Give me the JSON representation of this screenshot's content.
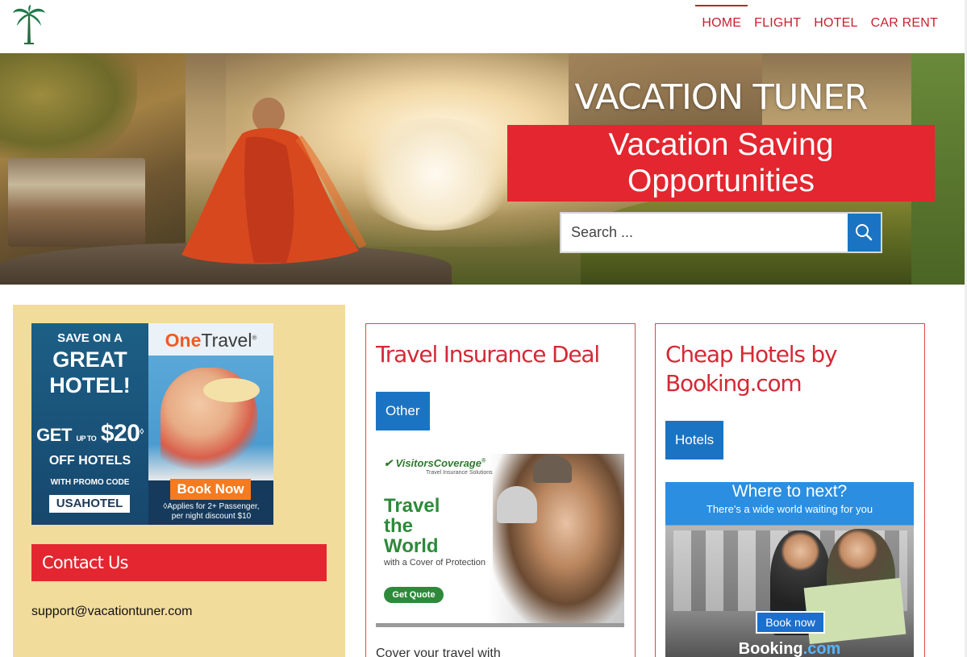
{
  "header": {
    "logo_icon": "palm-tree-icon",
    "nav": [
      {
        "label": "HOME",
        "active": true
      },
      {
        "label": "FLIGHT",
        "active": false
      },
      {
        "label": "HOTEL",
        "active": false
      },
      {
        "label": "CAR RENT",
        "active": false
      }
    ]
  },
  "hero": {
    "site_title": "VACATION TUNER",
    "tagline_line1": "Vacation Saving",
    "tagline_line2": "Opportunities",
    "search_placeholder": "Search ...",
    "search_icon": "search-icon"
  },
  "sidebar": {
    "ad": {
      "line1": "SAVE ON A",
      "line2": "GREAT",
      "line3": "HOTEL!",
      "get": "GET",
      "up_to": "UP TO",
      "amount": "$20",
      "sup": "◊",
      "off": "OFF HOTELS",
      "promo": "WITH PROMO CODE",
      "code": "USAHOTEL",
      "brand_one": "One",
      "brand_travel": "Travel",
      "brand_mark": "®",
      "book_now": "Book Now",
      "fine_line1": "◊Applies for 2+ Passenger,",
      "fine_line2": "per night discount $10"
    },
    "contact_heading": "Contact Us",
    "contact_email": "support@vacationtuner.com"
  },
  "cards": [
    {
      "title": "Travel Insurance Deal",
      "tag": "Other",
      "ad": {
        "logo": "VisitorsCoverage",
        "logo_mark": "®",
        "logo_sub": "Travel Insurance Solutions",
        "head1": "Travel",
        "head2": "the",
        "head3": "World",
        "cover": "with a Cover of Protection",
        "button": "Get Quote"
      },
      "excerpt": "Cover your travel with"
    },
    {
      "title": "Cheap Hotels by Booking.com",
      "tag": "Hotels",
      "ad": {
        "headline": "Where to next?",
        "subline": "There's a wide world waiting for you",
        "button": "Book now",
        "logo_a": "Booking",
        "logo_b": ".com"
      }
    }
  ],
  "colors": {
    "brand_red": "#e3262f",
    "nav_red": "#c8202f",
    "tag_blue": "#1b74c3",
    "sidebar_bg": "#f2dc9b"
  }
}
